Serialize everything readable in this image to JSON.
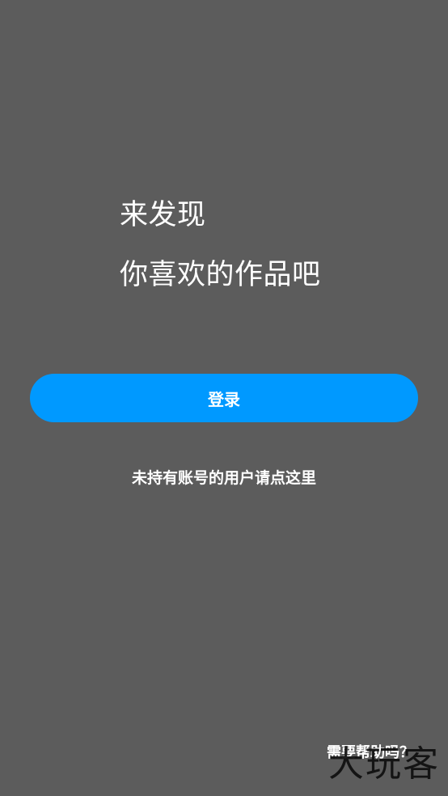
{
  "colors": {
    "background": "#5c5c5c",
    "accent": "#0099ff",
    "text": "#ffffff"
  },
  "headline": {
    "line1": "来发现",
    "line2": "你喜欢的作品吧"
  },
  "login_button": {
    "label": "登录"
  },
  "register_link": {
    "label": "未持有账号的用户请点这里"
  },
  "help_link": {
    "label": "需要帮助吗？"
  },
  "watermark": {
    "text": "大玩客"
  }
}
